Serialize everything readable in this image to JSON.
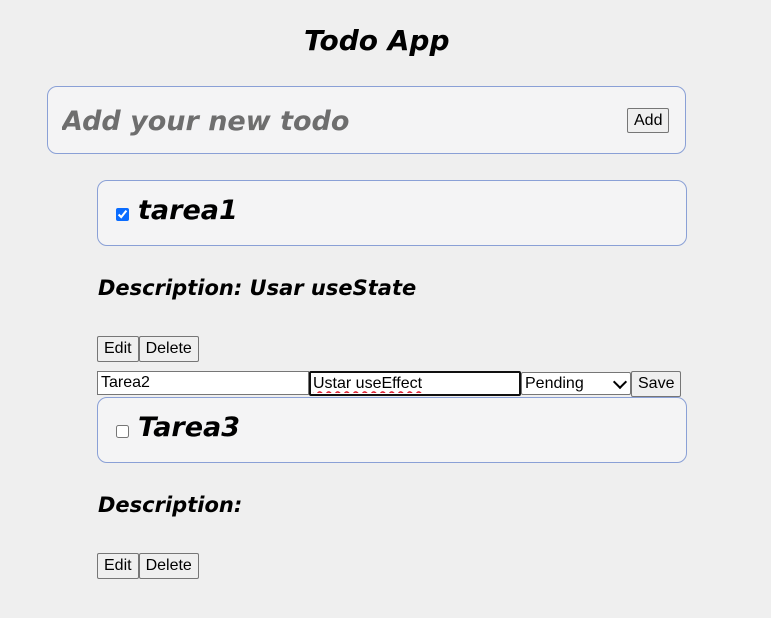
{
  "app": {
    "title": "Todo App"
  },
  "add_form": {
    "placeholder": "Add your new todo",
    "value": "",
    "add_label": "Add"
  },
  "todos": [
    {
      "title": "tarea1",
      "completed": true,
      "description_text": "Description: Usar useState",
      "edit_label": "Edit",
      "delete_label": "Delete"
    },
    {
      "editing": true,
      "title_value": "Tarea2",
      "description_value": "Ustar useEffect",
      "status_value": "Pending",
      "save_label": "Save"
    },
    {
      "title": "Tarea3",
      "completed": false,
      "description_text": "Description:",
      "edit_label": "Edit",
      "delete_label": "Delete"
    }
  ],
  "colors": {
    "background": "#efefef",
    "card_border": "#8aa0d6",
    "card_background": "#f4f4f5",
    "checkbox_accent": "#0a6cff"
  }
}
